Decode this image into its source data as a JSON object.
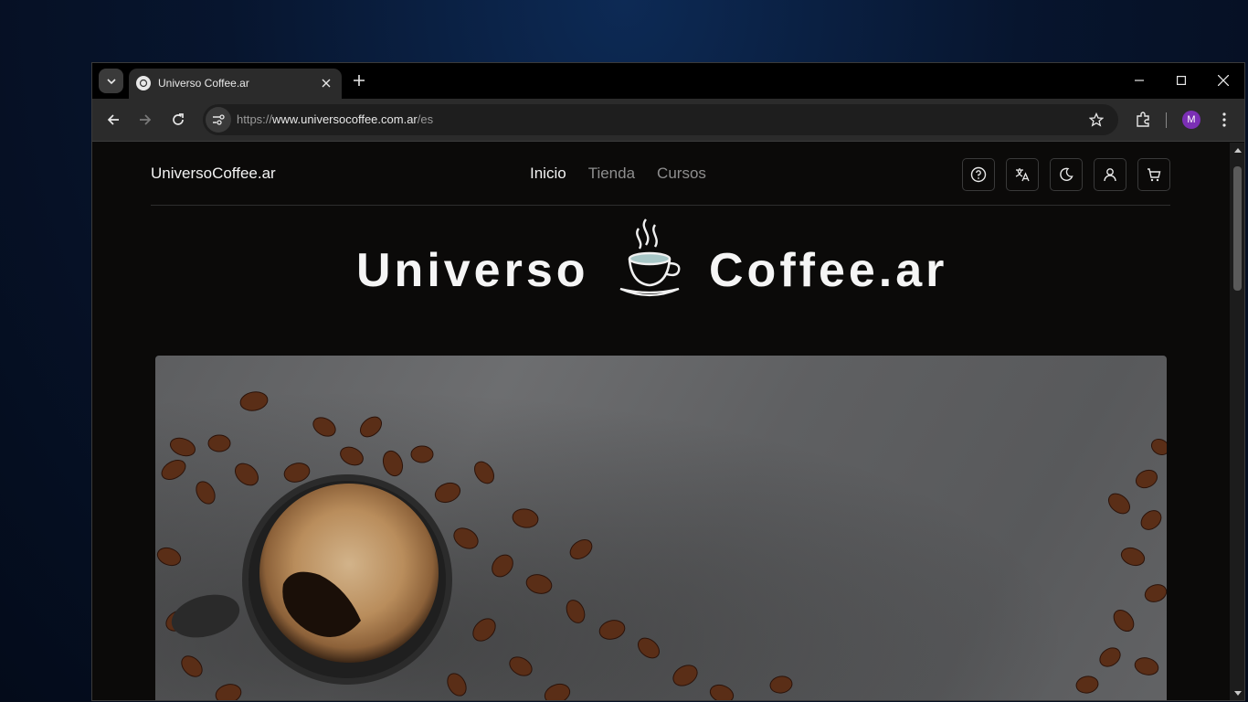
{
  "browser": {
    "tab_title": "Universo Coffee.ar",
    "url_scheme": "https://",
    "url_host": "www.universocoffee.com.ar",
    "url_path": "/es",
    "profile_initial": "M"
  },
  "site": {
    "brand": "UniversoCoffee.ar",
    "nav": [
      "Inicio",
      "Tienda",
      "Cursos"
    ],
    "logo_left": "Universo",
    "logo_right": "Coffee.ar"
  },
  "colors": {
    "page_bg": "#0b0a09",
    "nav_active": "#f2f2f2",
    "nav_inactive": "#8e8e8e",
    "profile": "#7b2fb5"
  }
}
